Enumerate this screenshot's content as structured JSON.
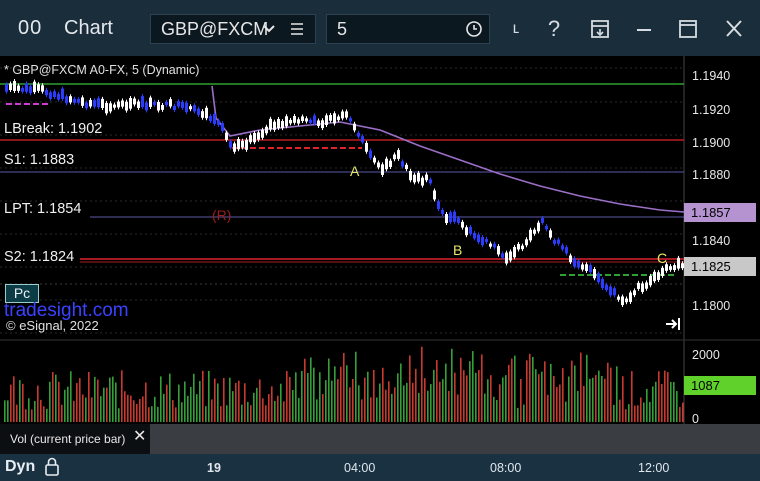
{
  "window": {
    "title": "Chart",
    "app_icon_text": "00",
    "symbol_value": "GBP@FXCM",
    "interval_value": "5",
    "help_icon": "?",
    "cursor_icon": "ʟ"
  },
  "chart": {
    "study_label": "* GBP@FXCM A0-FX, 5 (Dynamic)",
    "levels": {
      "lbreak": "LBreak: 1.1902",
      "s1": "S1: 1.1883",
      "lpt": "LPT: 1.1854",
      "s2": "S2: 1.1824"
    },
    "markers": {
      "a": "A",
      "b": "B",
      "c": "C",
      "r": "(R)"
    },
    "watermark": "tradesight.com",
    "copyright": "© eSignal, 2022",
    "pc_button": "Pc",
    "price_axis": [
      "1.1940",
      "1.1920",
      "1.1900",
      "1.1880",
      "1.1840",
      "1.1800"
    ],
    "price_tags": {
      "ma_value": "1.1857",
      "last_price": "1.1825"
    },
    "volume_axis": [
      "2000",
      "0"
    ],
    "volume_tag": "1087",
    "volume_panel_label": "Vol (current price bar)",
    "time_axis": [
      "19",
      "04:00",
      "08:00",
      "12:00"
    ],
    "footer_label": "Dyn"
  },
  "colors": {
    "up_bar": "#ffffff",
    "down_bar": "#2b3cff",
    "ma": "#9b6fc8",
    "green_line": "#2fa032",
    "red_line": "#e0232b",
    "volume_up": "#35a03a",
    "volume_down": "#c83a30",
    "last_price_tag": "#c8c8c8",
    "volume_tag": "#5fd12a"
  }
}
